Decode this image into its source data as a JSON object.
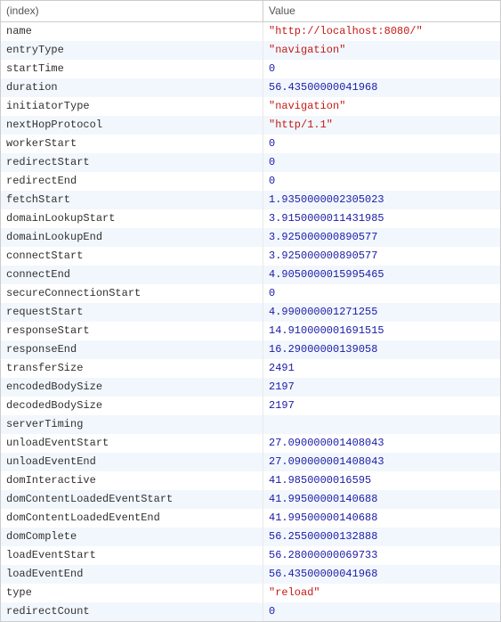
{
  "header": {
    "index": "(index)",
    "value": "Value"
  },
  "rows": [
    {
      "key": "name",
      "value": "\"http://localhost:8080/\"",
      "kind": "string"
    },
    {
      "key": "entryType",
      "value": "\"navigation\"",
      "kind": "string"
    },
    {
      "key": "startTime",
      "value": "0",
      "kind": "number"
    },
    {
      "key": "duration",
      "value": "56.43500000041968",
      "kind": "number"
    },
    {
      "key": "initiatorType",
      "value": "\"navigation\"",
      "kind": "string"
    },
    {
      "key": "nextHopProtocol",
      "value": "\"http/1.1\"",
      "kind": "string"
    },
    {
      "key": "workerStart",
      "value": "0",
      "kind": "number"
    },
    {
      "key": "redirectStart",
      "value": "0",
      "kind": "number"
    },
    {
      "key": "redirectEnd",
      "value": "0",
      "kind": "number"
    },
    {
      "key": "fetchStart",
      "value": "1.9350000002305023",
      "kind": "number"
    },
    {
      "key": "domainLookupStart",
      "value": "3.9150000011431985",
      "kind": "number"
    },
    {
      "key": "domainLookupEnd",
      "value": "3.925000000890577",
      "kind": "number"
    },
    {
      "key": "connectStart",
      "value": "3.925000000890577",
      "kind": "number"
    },
    {
      "key": "connectEnd",
      "value": "4.9050000015995465",
      "kind": "number"
    },
    {
      "key": "secureConnectionStart",
      "value": "0",
      "kind": "number"
    },
    {
      "key": "requestStart",
      "value": "4.990000001271255",
      "kind": "number"
    },
    {
      "key": "responseStart",
      "value": "14.910000001691515",
      "kind": "number"
    },
    {
      "key": "responseEnd",
      "value": "16.29000000139058",
      "kind": "number"
    },
    {
      "key": "transferSize",
      "value": "2491",
      "kind": "number"
    },
    {
      "key": "encodedBodySize",
      "value": "2197",
      "kind": "number"
    },
    {
      "key": "decodedBodySize",
      "value": "2197",
      "kind": "number"
    },
    {
      "key": "serverTiming",
      "value": "",
      "kind": "empty"
    },
    {
      "key": "unloadEventStart",
      "value": "27.090000001408043",
      "kind": "number"
    },
    {
      "key": "unloadEventEnd",
      "value": "27.090000001408043",
      "kind": "number"
    },
    {
      "key": "domInteractive",
      "value": "41.9850000016595",
      "kind": "number"
    },
    {
      "key": "domContentLoadedEventStart",
      "value": "41.99500000140688",
      "kind": "number"
    },
    {
      "key": "domContentLoadedEventEnd",
      "value": "41.99500000140688",
      "kind": "number"
    },
    {
      "key": "domComplete",
      "value": "56.25500000132888",
      "kind": "number"
    },
    {
      "key": "loadEventStart",
      "value": "56.28000000069733",
      "kind": "number"
    },
    {
      "key": "loadEventEnd",
      "value": "56.43500000041968",
      "kind": "number"
    },
    {
      "key": "type",
      "value": "\"reload\"",
      "kind": "string"
    },
    {
      "key": "redirectCount",
      "value": "0",
      "kind": "number"
    }
  ]
}
